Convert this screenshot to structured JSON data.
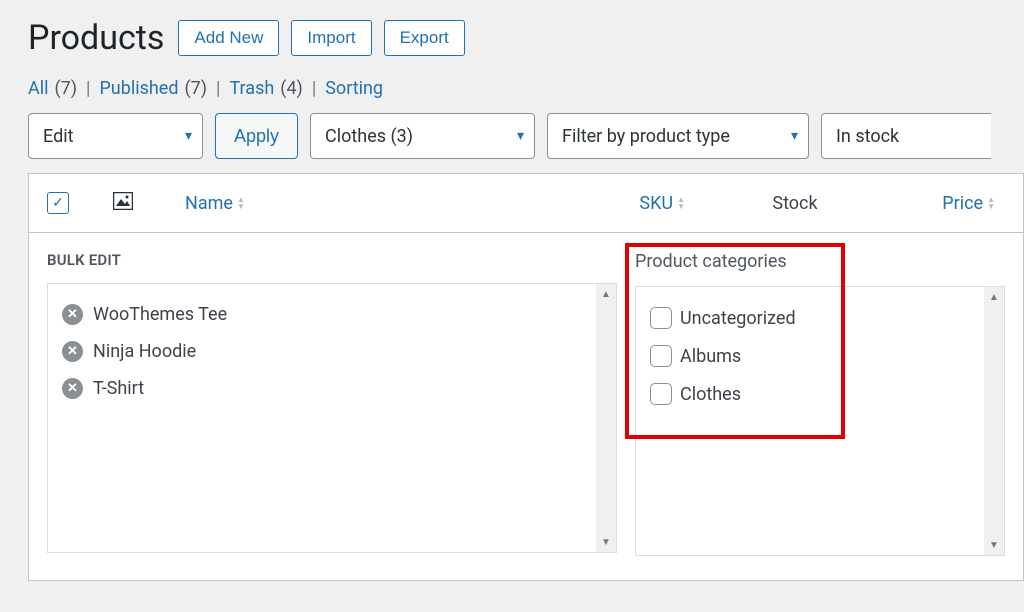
{
  "header": {
    "title": "Products",
    "add_new": "Add New",
    "import": "Import",
    "export": "Export"
  },
  "status": {
    "all_label": "All",
    "all_count": "(7)",
    "published_label": "Published",
    "published_count": "(7)",
    "trash_label": "Trash",
    "trash_count": "(4)",
    "sorting_label": "Sorting"
  },
  "filters": {
    "bulk_action_value": "Edit",
    "apply": "Apply",
    "category_value": "Clothes  (3)",
    "type_value": "Filter by product type",
    "stock_value": "In stock"
  },
  "columns": {
    "name": "Name",
    "sku": "SKU",
    "stock": "Stock",
    "price": "Price"
  },
  "bulk_edit": {
    "title": "BULK EDIT",
    "items": [
      "WooThemes Tee",
      "Ninja Hoodie",
      "T-Shirt"
    ],
    "categories_title": "Product categories",
    "categories": [
      "Uncategorized",
      "Albums",
      "Clothes"
    ]
  }
}
